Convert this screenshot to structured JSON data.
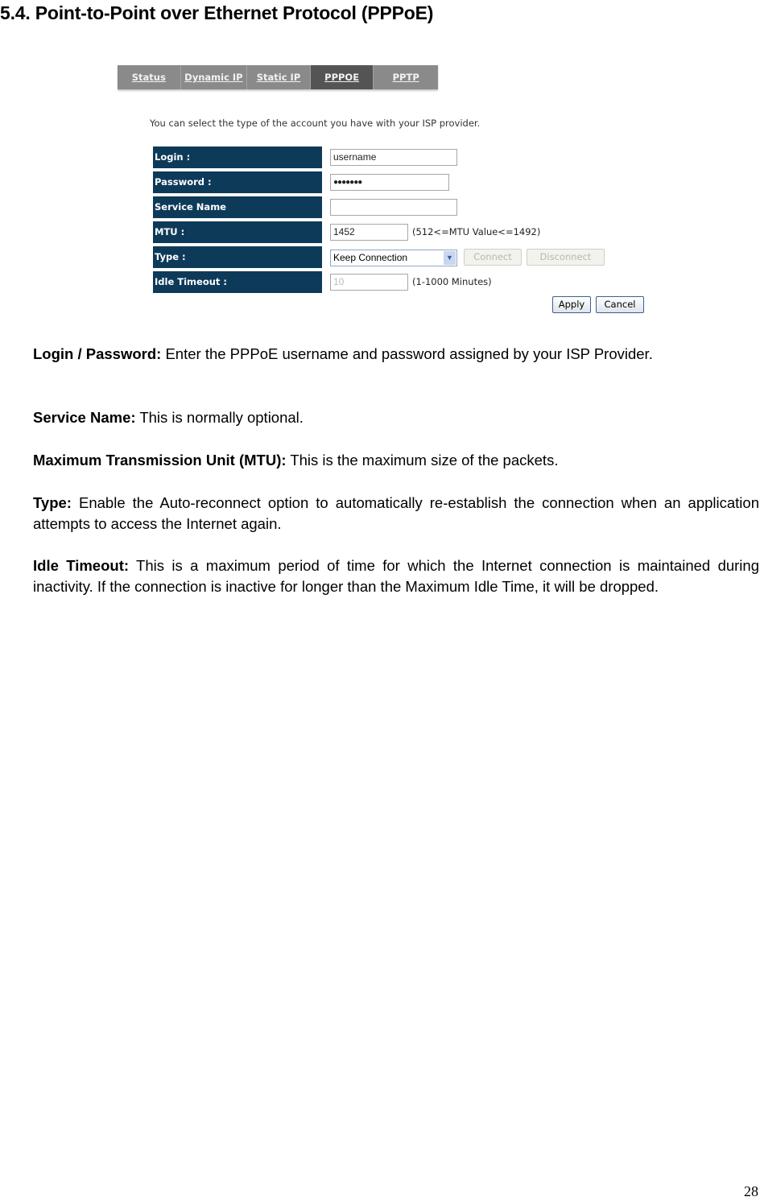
{
  "document": {
    "section_title": "5.4. Point-to-Point over Ethernet Protocol (PPPoE)",
    "page_number": "28"
  },
  "screenshot": {
    "tabs": [
      {
        "label": "Status",
        "active": false
      },
      {
        "label": "Dynamic IP",
        "active": false
      },
      {
        "label": "Static IP",
        "active": false
      },
      {
        "label": "PPPOE",
        "active": true
      },
      {
        "label": "PPTP",
        "active": false
      }
    ],
    "intro": "You can select the type of the account you have with your ISP provider.",
    "fields": {
      "login": {
        "label": "Login :",
        "value": "username"
      },
      "password": {
        "label": "Password :",
        "value": "●●●●●●●"
      },
      "service_name": {
        "label": "Service Name",
        "value": ""
      },
      "mtu": {
        "label": "MTU :",
        "value": "1452",
        "hint": "(512<=MTU Value<=1492)"
      },
      "type": {
        "label": "Type :",
        "selected": "Keep Connection",
        "connect_label": "Connect",
        "disconnect_label": "Disconnect"
      },
      "idle_timeout": {
        "label": "Idle Timeout :",
        "value": "10",
        "hint": "(1-1000 Minutes)"
      }
    },
    "buttons": {
      "apply": "Apply",
      "cancel": "Cancel"
    }
  },
  "descriptions": [
    {
      "term": "Login / Password:",
      "text": " Enter the PPPoE username and password assigned by your ISP Provider."
    },
    {
      "term": "Service Name:",
      "text": " This is normally optional."
    },
    {
      "term": "Maximum Transmission Unit (MTU):",
      "text": " This is the maximum size of the packets."
    },
    {
      "term": "Type:",
      "text": " Enable the Auto-reconnect option to automatically re-establish the connection when an application attempts to access the Internet again."
    },
    {
      "term": "Idle Timeout:",
      "text": " This is a maximum period of time for which the Internet connection is maintained during inactivity. If the connection is inactive for longer than the Maximum Idle Time, it will be dropped."
    }
  ]
}
